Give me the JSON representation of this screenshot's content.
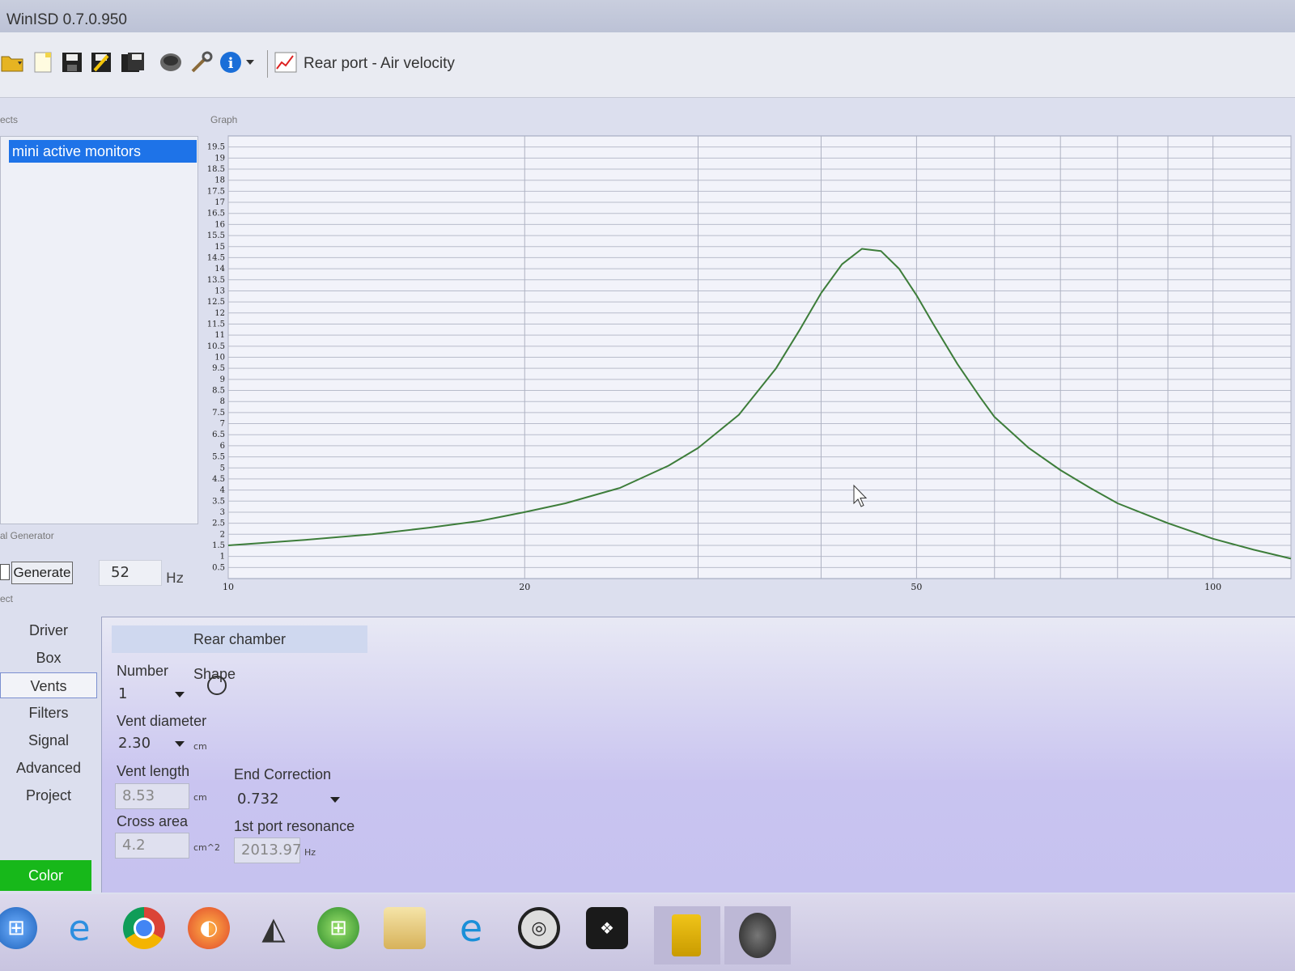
{
  "window": {
    "title": "WinISD 0.7.0.950"
  },
  "toolbar": {
    "graph_label": "Rear port - Air velocity"
  },
  "sections": {
    "projects": "ects",
    "graph": "Graph",
    "signal_generator": "al Generator",
    "select": "ect"
  },
  "project_list": {
    "items": [
      "mini active monitors"
    ]
  },
  "signal_generator": {
    "button": "Generate",
    "value": "52",
    "unit": "Hz"
  },
  "nav": {
    "items": [
      "Driver",
      "Box",
      "Vents",
      "Filters",
      "Signal",
      "Advanced",
      "Project"
    ],
    "selected": "Vents",
    "color_button": "Color"
  },
  "vents": {
    "header": "Rear chamber",
    "number_label": "Number",
    "number_value": "1",
    "shape_label": "Shape",
    "diameter_label": "Vent diameter",
    "diameter_value": "2.30",
    "diameter_unit": "cm",
    "length_label": "Vent length",
    "length_value": "8.53",
    "length_unit": "cm",
    "end_correction_label": "End Correction",
    "end_correction_value": "0.732",
    "cross_area_label": "Cross area",
    "cross_area_value": "4.2",
    "cross_area_unit": "cm^2",
    "resonance_label": "1st port resonance",
    "resonance_value": "2013.97",
    "resonance_unit": "Hz"
  },
  "chart_data": {
    "type": "line",
    "x_scale": "log",
    "xlim": [
      10,
      120
    ],
    "ylim": [
      0,
      20
    ],
    "x_ticks": [
      "10",
      "20",
      "50",
      "100"
    ],
    "y_ticks": [
      "0.5",
      "1",
      "1.5",
      "2",
      "2.5",
      "3",
      "3.5",
      "4",
      "4.5",
      "5",
      "5.5",
      "6",
      "6.5",
      "7",
      "7.5",
      "8",
      "8.5",
      "9",
      "9.5",
      "10",
      "10.5",
      "11",
      "11.5",
      "12",
      "12.5",
      "13",
      "13.5",
      "14",
      "14.5",
      "15",
      "15.5",
      "16",
      "16.5",
      "17",
      "17.5",
      "18",
      "18.5",
      "19",
      "19.5"
    ],
    "grid": true,
    "line_color": "#3d7d3a",
    "series": [
      {
        "x": [
          10,
          12,
          14,
          16,
          18,
          20,
          22,
          25,
          28,
          30,
          33,
          36,
          38,
          40,
          42,
          44,
          46,
          48,
          50,
          52,
          55,
          58,
          60,
          65,
          70,
          75,
          80,
          90,
          100,
          110,
          120
        ],
        "values": [
          1.5,
          1.75,
          2.0,
          2.3,
          2.6,
          3.0,
          3.4,
          4.1,
          5.1,
          5.9,
          7.4,
          9.5,
          11.2,
          12.9,
          14.2,
          14.9,
          14.8,
          14.0,
          12.8,
          11.5,
          9.7,
          8.2,
          7.3,
          5.9,
          4.9,
          4.1,
          3.4,
          2.5,
          1.8,
          1.3,
          0.9
        ]
      }
    ]
  }
}
